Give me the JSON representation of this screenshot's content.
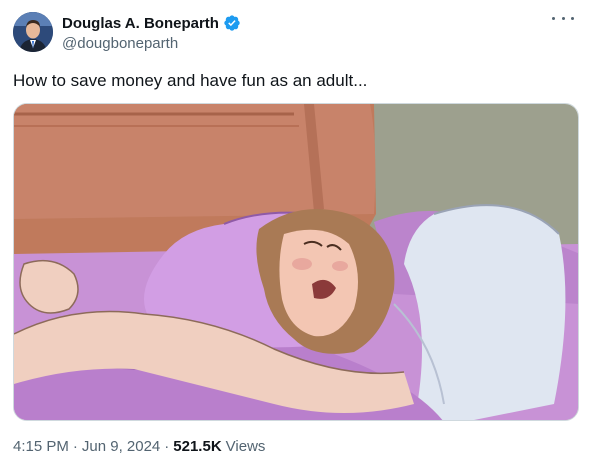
{
  "author": {
    "display_name": "Douglas A. Boneparth",
    "handle": "@dougboneparth",
    "verified": true,
    "verified_color": "#1d9bf0"
  },
  "more_icon": "more-horizontal-icon",
  "tweet": {
    "text": "How to save money and have fun as an adult...",
    "media_icon": "cartoon-image"
  },
  "meta": {
    "time": "4:15 PM",
    "separator": "·",
    "date": "Jun 9, 2024",
    "views_count": "521.5K",
    "views_label": "Views"
  }
}
